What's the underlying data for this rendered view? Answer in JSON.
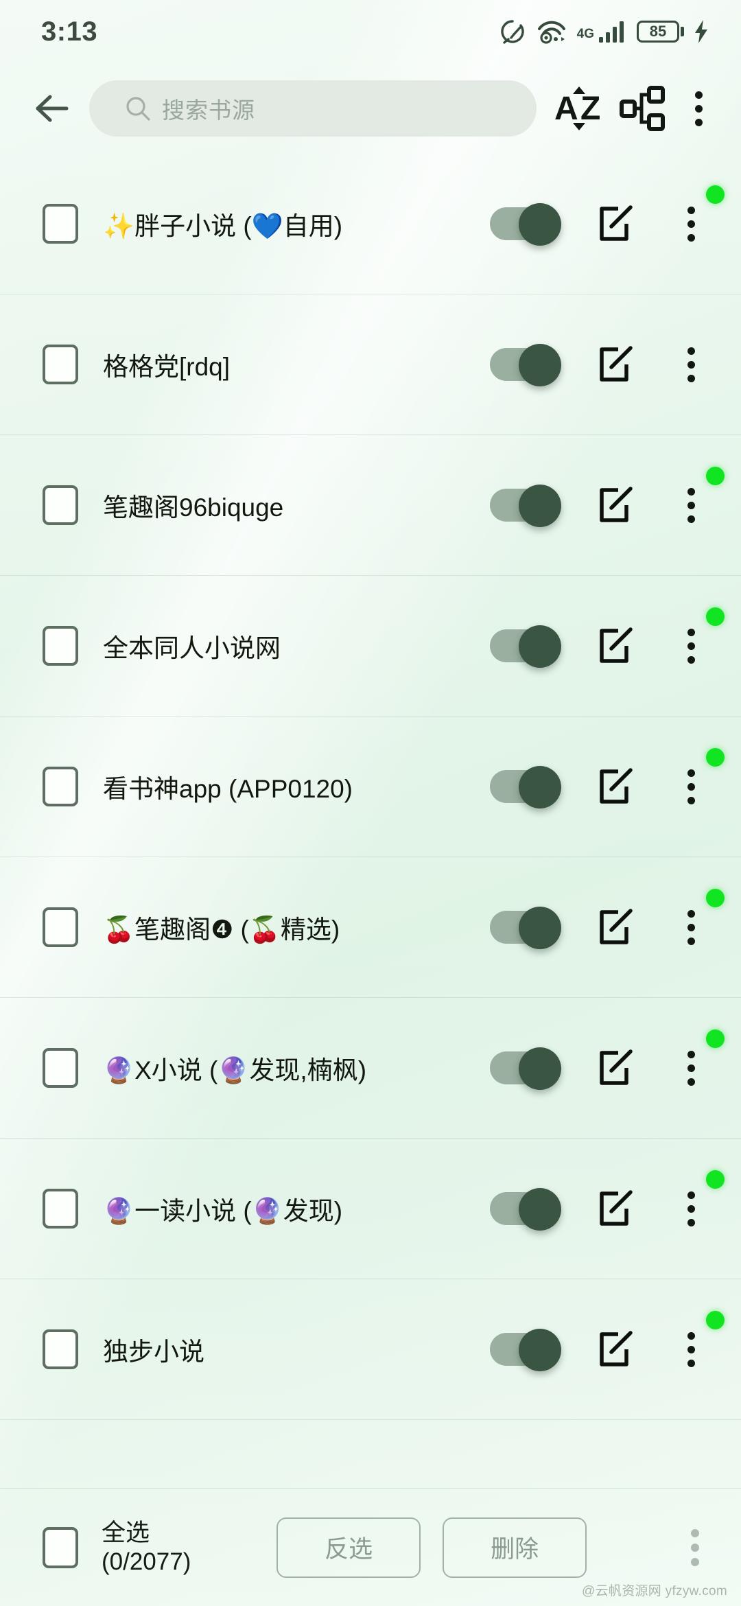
{
  "status_bar": {
    "time": "3:13",
    "battery_level": "85",
    "network_type": "4G",
    "icons": [
      "speed-meter-icon",
      "wifi-hotspot-icon",
      "signal-bars-icon",
      "battery-icon",
      "charging-bolt-icon"
    ]
  },
  "toolbar": {
    "back_icon": "back-arrow-icon",
    "search_placeholder": "搜索书源",
    "search_value": "",
    "sort_icon_label": "AZ",
    "group_icon": "source-group-icon",
    "overflow_icon": "more-vertical-icon"
  },
  "colors": {
    "page_background": "#f2faf4",
    "switch_track": "#9aafa0",
    "switch_thumb": "#3b5543",
    "status_led": "#11e522",
    "search_field": "#e3eae3",
    "text_primary": "#13180f",
    "text_muted": "#8c9b90"
  },
  "list": {
    "rows": [
      {
        "title": "✨胖子小说 (💙自用)",
        "enabled": true,
        "checked": false,
        "has_led": true
      },
      {
        "title": "格格党[rdq]",
        "enabled": true,
        "checked": false,
        "has_led": false
      },
      {
        "title": "笔趣阁96biquge",
        "enabled": true,
        "checked": false,
        "has_led": true
      },
      {
        "title": "全本同人小说网",
        "enabled": true,
        "checked": false,
        "has_led": true
      },
      {
        "title": "看书神app (APP0120)",
        "enabled": true,
        "checked": false,
        "has_led": true
      },
      {
        "title": "🍒笔趣阁❹ (🍒精选)",
        "enabled": true,
        "checked": false,
        "has_led": true
      },
      {
        "title": "🔮X小说 (🔮发现,楠枫)",
        "enabled": true,
        "checked": false,
        "has_led": true
      },
      {
        "title": "🔮一读小说 (🔮发现)",
        "enabled": true,
        "checked": false,
        "has_led": true
      },
      {
        "title": "独步小说",
        "enabled": true,
        "checked": false,
        "has_led": true
      }
    ]
  },
  "bottom_bar": {
    "select_all_label": "全选",
    "selection_count": "(0/2077)",
    "invert_label": "反选",
    "delete_label": "删除",
    "overflow_icon": "more-vertical-icon",
    "select_all_checked": false
  },
  "watermark": "@云帆资源网 yfzyw.com"
}
